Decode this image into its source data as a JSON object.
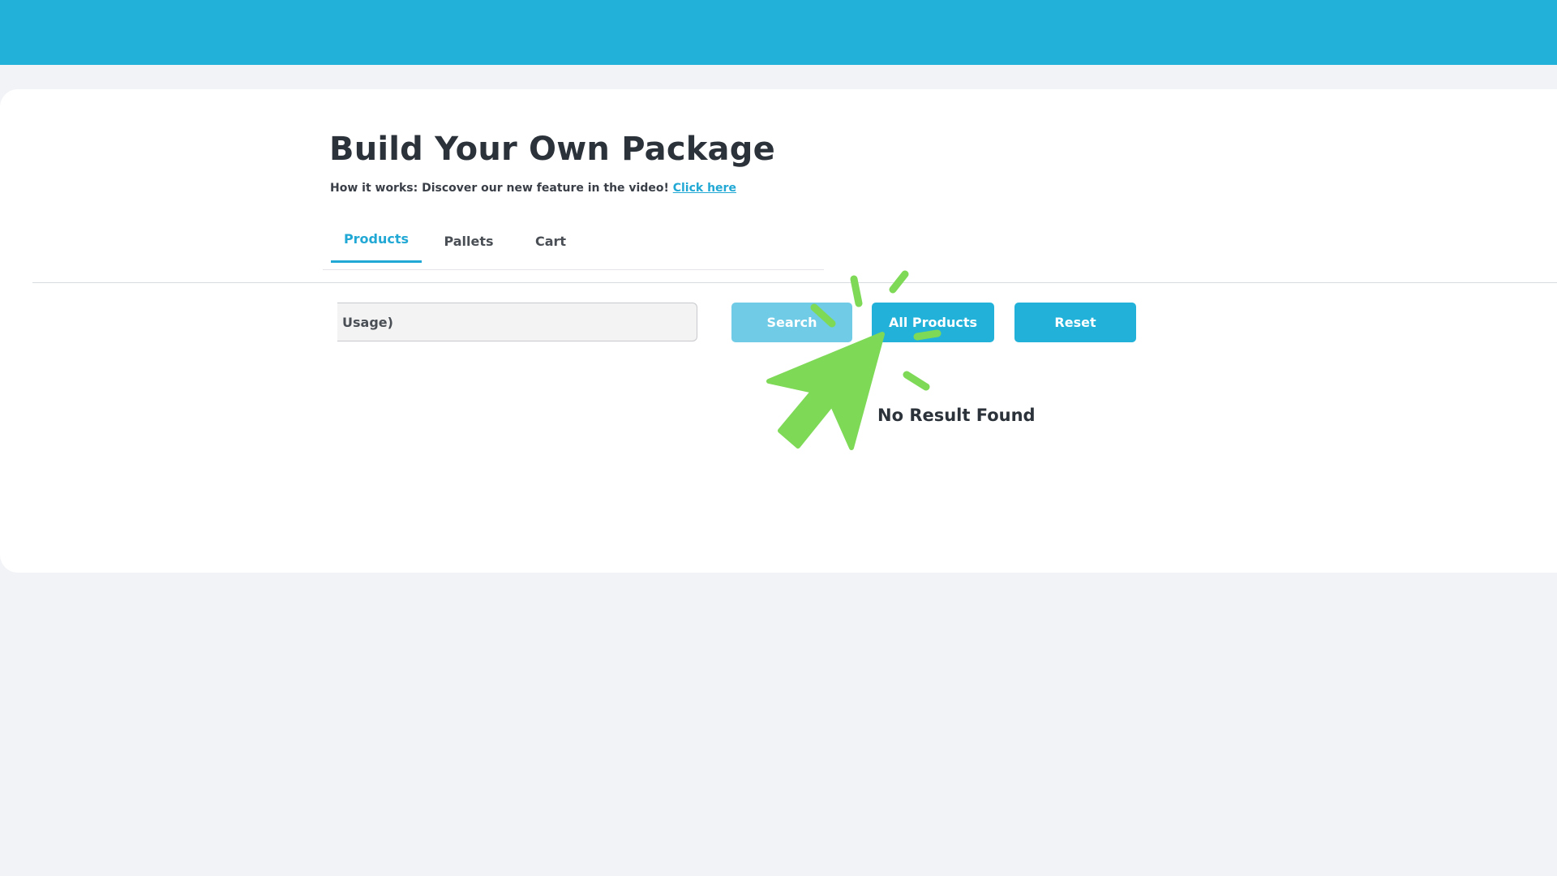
{
  "header": {
    "color": "#22b1d9"
  },
  "page": {
    "title": "Build Your Own Package",
    "howto_text": "How it works: Discover our new feature in the video! ",
    "howto_link": "Click here"
  },
  "tabs": [
    {
      "label": "Products",
      "active": true
    },
    {
      "label": "Pallets",
      "active": false
    },
    {
      "label": "Cart",
      "active": false
    }
  ],
  "search": {
    "value": "Usage)"
  },
  "buttons": {
    "search": "Search",
    "all_products": "All Products",
    "reset": "Reset"
  },
  "results": {
    "empty_message": "No Result Found"
  },
  "overlay": {
    "icon": "click-cursor-icon",
    "color": "#7ed957"
  }
}
